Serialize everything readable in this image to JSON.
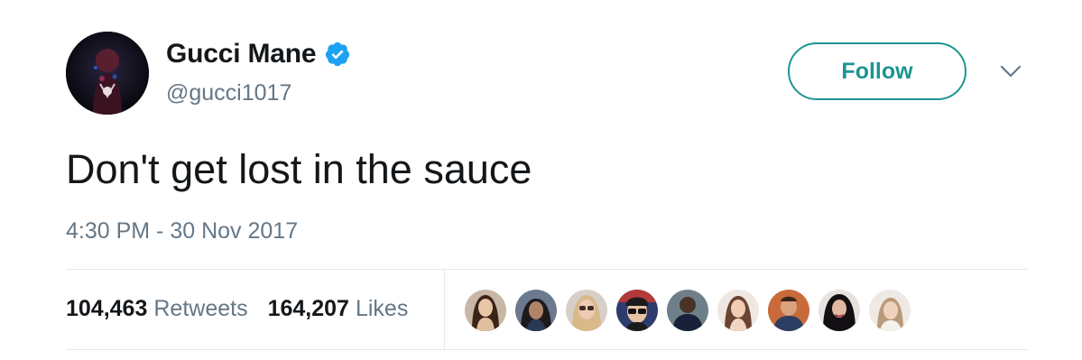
{
  "tweet": {
    "author_name": "Gucci Mane",
    "handle": "@gucci1017",
    "verified": true,
    "follow_label": "Follow",
    "text": "Don't get lost in the sauce",
    "timestamp": "4:30 PM - 30 Nov 2017"
  },
  "stats": {
    "retweets_count": "104,463",
    "retweets_label": "Retweets",
    "likes_count": "164,207",
    "likes_label": "Likes"
  },
  "likers": [
    {
      "name": "liker-avatar-1"
    },
    {
      "name": "liker-avatar-2"
    },
    {
      "name": "liker-avatar-3"
    },
    {
      "name": "liker-avatar-4"
    },
    {
      "name": "liker-avatar-5"
    },
    {
      "name": "liker-avatar-6"
    },
    {
      "name": "liker-avatar-7"
    },
    {
      "name": "liker-avatar-8"
    },
    {
      "name": "liker-avatar-9"
    }
  ],
  "icons": {
    "verified": "verified-badge-icon",
    "caret": "chevron-down-icon"
  },
  "colors": {
    "follow_accent": "#1b9593",
    "verified_blue": "#1da1f2",
    "secondary_text": "#657786",
    "primary_text": "#14171a",
    "divider": "#e1e8ed"
  }
}
